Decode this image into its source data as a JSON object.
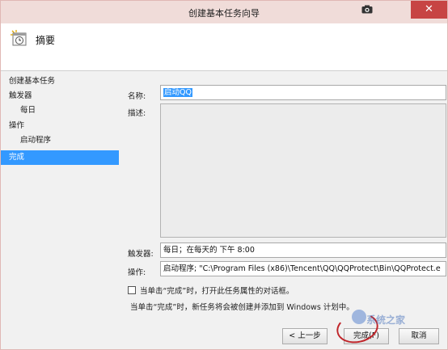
{
  "window": {
    "title": "创建基本任务向导",
    "close_glyph": "✕"
  },
  "header": {
    "title": "摘要",
    "icon": "clock-task-icon"
  },
  "nav": {
    "items": [
      {
        "label": "创建基本任务",
        "indent": false,
        "active": false
      },
      {
        "label": "触发器",
        "indent": false,
        "active": false
      },
      {
        "label": "每日",
        "indent": true,
        "active": false
      },
      {
        "label": "操作",
        "indent": false,
        "active": false
      },
      {
        "label": "启动程序",
        "indent": true,
        "active": false
      },
      {
        "label": "完成",
        "indent": false,
        "active": true
      }
    ]
  },
  "form": {
    "name_label": "名称:",
    "name_value": "启动QQ",
    "desc_label": "描述:",
    "trigger_label": "触发器:",
    "trigger_value": "每日；在每天的 下午 8:00",
    "action_label": "操作:",
    "action_value": "启动程序; \"C:\\Program Files (x86)\\Tencent\\QQ\\QQProtect\\Bin\\QQProtect.e"
  },
  "checkbox": {
    "label": "当单击“完成”时，打开此任务属性的对话框。",
    "checked": false
  },
  "info_text": "当单击“完成”时，新任务将会被创建并添加到 Windows 计划中。",
  "buttons": {
    "back": "< 上一步",
    "finish": "完成(F)",
    "cancel": "取消"
  },
  "watermark": "系统之家",
  "colors": {
    "title_bar": "#f0dcd9",
    "close": "#c74444",
    "selection": "#3399ff",
    "content_bg": "#f1f1f1",
    "annotation": "#c0262b"
  }
}
